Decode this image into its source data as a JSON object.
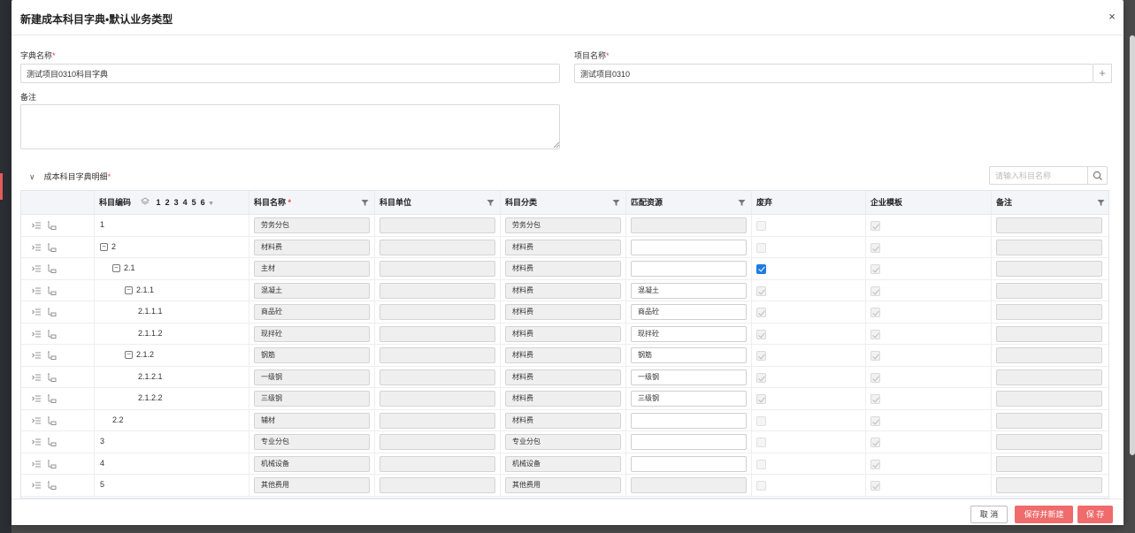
{
  "modal": {
    "title": "新建成本科目字典•默认业务类型",
    "close_label": "×"
  },
  "form": {
    "dict_name": {
      "label": "字典名称",
      "value": "测试项目0310科目字典"
    },
    "project_name": {
      "label": "项目名称",
      "value": "测试项目0310",
      "plus": "+"
    },
    "remark": {
      "label": "备注",
      "value": ""
    },
    "required_mark": "*"
  },
  "section": {
    "title": "成本科目字典明细",
    "chevron": "∨"
  },
  "search": {
    "placeholder": "请输入科目名称"
  },
  "table": {
    "headers": {
      "code": "科目编码",
      "name": "科目名称",
      "unit": "科目单位",
      "category": "科目分类",
      "resource": "匹配资源",
      "discard": "废弃",
      "template": "企业模板",
      "remark": "备注"
    },
    "levels": [
      "1",
      "2",
      "3",
      "4",
      "5",
      "6"
    ],
    "rows": [
      {
        "code": "1",
        "depth": 0,
        "toggle": "",
        "name": "劳务分包",
        "unit": "",
        "category": "劳务分包",
        "resource": "",
        "resource_state": "disabled",
        "discard": "disabled",
        "template": "disabled-checked"
      },
      {
        "code": "2",
        "depth": 0,
        "toggle": "−",
        "name": "材料费",
        "unit": "",
        "category": "材料费",
        "resource": "",
        "resource_state": "white",
        "discard": "disabled",
        "template": "disabled-checked"
      },
      {
        "code": "2.1",
        "depth": 1,
        "toggle": "−",
        "name": "主材",
        "unit": "",
        "category": "材料费",
        "resource": "",
        "resource_state": "white",
        "discard": "checked",
        "template": "disabled-checked"
      },
      {
        "code": "2.1.1",
        "depth": 2,
        "toggle": "−",
        "name": "混凝土",
        "unit": "",
        "category": "材料费",
        "resource": "混凝土",
        "resource_state": "white",
        "discard": "disabled-checked",
        "template": "disabled-checked"
      },
      {
        "code": "2.1.1.1",
        "depth": 3,
        "toggle": "",
        "name": "商品砼",
        "unit": "",
        "category": "材料费",
        "resource": "商品砼",
        "resource_state": "white",
        "discard": "disabled-checked",
        "template": "disabled-checked"
      },
      {
        "code": "2.1.1.2",
        "depth": 3,
        "toggle": "",
        "name": "现拌砼",
        "unit": "",
        "category": "材料费",
        "resource": "现拌砼",
        "resource_state": "white",
        "discard": "disabled-checked",
        "template": "disabled-checked"
      },
      {
        "code": "2.1.2",
        "depth": 2,
        "toggle": "−",
        "name": "钢筋",
        "unit": "",
        "category": "材料费",
        "resource": "钢筋",
        "resource_state": "white",
        "discard": "disabled-checked",
        "template": "disabled-checked"
      },
      {
        "code": "2.1.2.1",
        "depth": 3,
        "toggle": "",
        "name": "一级钢",
        "unit": "",
        "category": "材料费",
        "resource": "一级钢",
        "resource_state": "white",
        "discard": "disabled-checked",
        "template": "disabled-checked"
      },
      {
        "code": "2.1.2.2",
        "depth": 3,
        "toggle": "",
        "name": "三级钢",
        "unit": "",
        "category": "材料费",
        "resource": "三级钢",
        "resource_state": "white",
        "discard": "disabled-checked",
        "template": "disabled-checked"
      },
      {
        "code": "2.2",
        "depth": 1,
        "toggle": "",
        "name": "辅材",
        "unit": "",
        "category": "材料费",
        "resource": "",
        "resource_state": "white",
        "discard": "disabled",
        "template": "disabled-checked"
      },
      {
        "code": "3",
        "depth": 0,
        "toggle": "",
        "name": "专业分包",
        "unit": "",
        "category": "专业分包",
        "resource": "",
        "resource_state": "white",
        "discard": "disabled",
        "template": "disabled-checked"
      },
      {
        "code": "4",
        "depth": 0,
        "toggle": "",
        "name": "机械设备",
        "unit": "",
        "category": "机械设备",
        "resource": "",
        "resource_state": "white",
        "discard": "disabled",
        "template": "disabled-checked"
      },
      {
        "code": "5",
        "depth": 0,
        "toggle": "",
        "name": "其他费用",
        "unit": "",
        "category": "其他费用",
        "resource": "",
        "resource_state": "disabled",
        "discard": "disabled",
        "template": "disabled-checked"
      }
    ]
  },
  "footer": {
    "cancel": "取 消",
    "save_new": "保存并新建",
    "save": "保 存"
  },
  "colors": {
    "primary_red": "#f06b6b",
    "checkbox_blue": "#1f7be0",
    "required": "#e44444"
  }
}
